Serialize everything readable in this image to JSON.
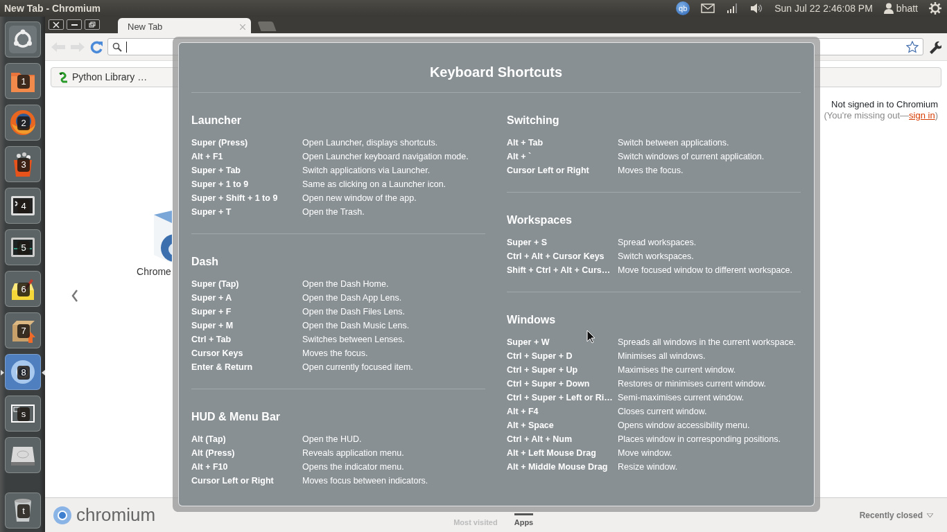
{
  "top_panel": {
    "title": "New Tab - Chromium",
    "indicators": [
      {
        "kind": "qb",
        "text": "qb"
      },
      {
        "kind": "mail"
      },
      {
        "kind": "signal"
      },
      {
        "kind": "volume"
      }
    ],
    "clock": "Sun Jul 22  2:46:08 PM",
    "user": "bhatt"
  },
  "launcher": [
    {
      "kind": "home",
      "selected": false
    },
    {
      "kind": "folder",
      "badge": "1",
      "selected": false
    },
    {
      "kind": "firefox",
      "badge": "2",
      "selected": false
    },
    {
      "kind": "software",
      "badge": "3",
      "selected": false
    },
    {
      "kind": "terminal",
      "badge": "4",
      "selected": false
    },
    {
      "kind": "monitor",
      "badge": "5",
      "selected": false
    },
    {
      "kind": "notes",
      "badge": "6",
      "selected": false
    },
    {
      "kind": "package",
      "badge": "7",
      "selected": false
    },
    {
      "kind": "chromium",
      "badge": "8",
      "selected": true
    },
    {
      "kind": "workspaces",
      "badge": "s",
      "selected": false
    },
    {
      "kind": "drive",
      "selected": false
    },
    {
      "kind": "trash",
      "badge": "t",
      "selected": false
    }
  ],
  "browser": {
    "window_buttons": [
      {
        "kind": "close"
      },
      {
        "kind": "minimize"
      },
      {
        "kind": "restore"
      }
    ],
    "tabs": [
      {
        "title": "New Tab",
        "selected": true
      }
    ],
    "bookmarks": [
      {
        "title": "Python Library …"
      }
    ],
    "sign_in": {
      "status": "Not signed in to Chromium",
      "prompt": "(You're missing out—",
      "link": "sign in",
      "end": ")"
    },
    "apps": [
      {
        "name": "Chrome"
      }
    ],
    "footer": {
      "logo": "chromium",
      "sections": [
        {
          "label": "Most visited",
          "selected": false
        },
        {
          "label": "Apps",
          "selected": true
        }
      ],
      "recently_closed": "Recently closed"
    }
  },
  "shortcuts_overlay": {
    "title": "Keyboard Shortcuts",
    "columns": [
      [
        {
          "title": "Launcher",
          "shortcuts": [
            {
              "keys": "Super (Press)",
              "action": "Open Launcher, displays shortcuts."
            },
            {
              "keys": "Alt + F1",
              "action": "Open Launcher keyboard navigation mode."
            },
            {
              "keys": "Super + Tab",
              "action": "Switch applications via Launcher."
            },
            {
              "keys": "Super + 1 to 9",
              "action": "Same as clicking on a Launcher icon."
            },
            {
              "keys": "Super + Shift + 1 to 9",
              "action": "Open new window of the app."
            },
            {
              "keys": "Super + T",
              "action": "Open the Trash."
            }
          ]
        },
        {
          "title": "Dash",
          "shortcuts": [
            {
              "keys": "Super (Tap)",
              "action": "Open the Dash Home."
            },
            {
              "keys": "Super + A",
              "action": "Open the Dash App Lens."
            },
            {
              "keys": "Super + F",
              "action": "Open the Dash Files Lens."
            },
            {
              "keys": "Super + M",
              "action": "Open the Dash Music Lens."
            },
            {
              "keys": "Ctrl + Tab",
              "action": "Switches between Lenses."
            },
            {
              "keys": "Cursor Keys",
              "action": "Moves the focus."
            },
            {
              "keys": "Enter & Return",
              "action": "Open currently focused item."
            }
          ]
        },
        {
          "title": "HUD & Menu Bar",
          "shortcuts": [
            {
              "keys": "Alt (Tap)",
              "action": "Open the HUD."
            },
            {
              "keys": "Alt (Press)",
              "action": "Reveals application menu."
            },
            {
              "keys": "Alt + F10",
              "action": "Opens the indicator menu."
            },
            {
              "keys": "Cursor Left or Right",
              "action": "Moves focus between indicators."
            }
          ]
        }
      ],
      [
        {
          "title": "Switching",
          "shortcuts": [
            {
              "keys": "Alt + Tab",
              "action": "Switch between applications."
            },
            {
              "keys": "Alt + `",
              "action": "Switch windows of current application."
            },
            {
              "keys": "Cursor Left or Right",
              "action": "Moves the focus."
            }
          ]
        },
        {
          "title": "Workspaces",
          "shortcuts": [
            {
              "keys": "Super + S",
              "action": "Spread workspaces."
            },
            {
              "keys": "Ctrl + Alt + Cursor Keys",
              "action": "Switch workspaces."
            },
            {
              "keys": "Shift + Ctrl + Alt + Curs…",
              "action": "Move focused window to different workspace."
            }
          ]
        },
        {
          "title": "Windows",
          "shortcuts": [
            {
              "keys": "Super + W",
              "action": "Spreads all windows in the current workspace."
            },
            {
              "keys": "Ctrl + Super + D",
              "action": "Minimises all windows."
            },
            {
              "keys": "Ctrl + Super + Up",
              "action": "Maximises the current window."
            },
            {
              "keys": "Ctrl + Super + Down",
              "action": "Restores or minimises current window."
            },
            {
              "keys": "Ctrl + Super + Left or Ri…",
              "action": "Semi-maximises current window."
            },
            {
              "keys": "Alt + F4",
              "action": "Closes current window."
            },
            {
              "keys": "Alt + Space",
              "action": "Opens window accessibility menu."
            },
            {
              "keys": "Ctrl + Alt + Num",
              "action": "Places window in corresponding positions."
            },
            {
              "keys": "Alt + Left Mouse Drag",
              "action": "Move window."
            },
            {
              "keys": "Alt + Middle Mouse Drag",
              "action": "Resize window."
            }
          ]
        }
      ]
    ]
  }
}
